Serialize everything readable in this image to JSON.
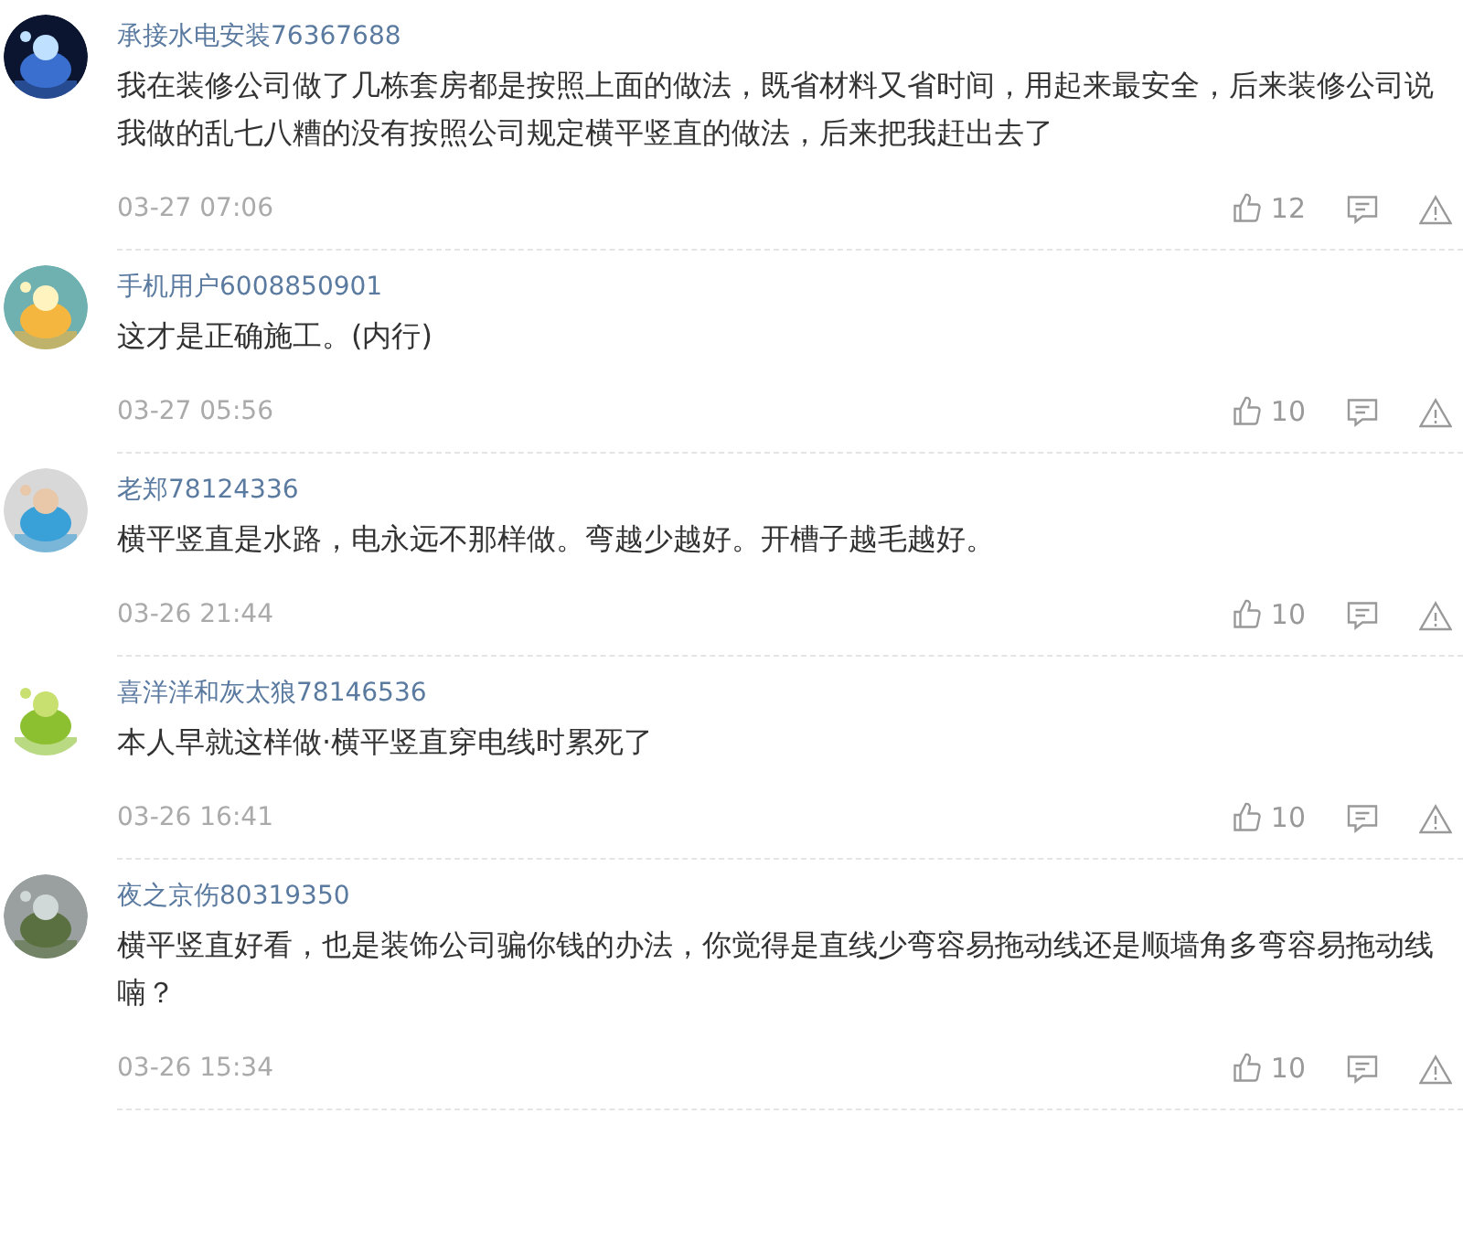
{
  "comments": [
    {
      "user": "承接水电安装76367688",
      "text": "我在装修公司做了几栋套房都是按照上面的做法，既省材料又省时间，用起来最安全，后来装修公司说我做的乱七八糟的没有按照公司规定横平竖直的做法，后来把我赶出去了",
      "time": "03-27 07:06",
      "likes": "12"
    },
    {
      "user": "手机用户6008850901",
      "text": "这才是正确施工。(内行)",
      "time": "03-27 05:56",
      "likes": "10"
    },
    {
      "user": "老郑78124336",
      "text": "横平竖直是水路，电永远不那样做。弯越少越好。开槽子越毛越好。",
      "time": "03-26 21:44",
      "likes": "10"
    },
    {
      "user": "喜洋洋和灰太狼78146536",
      "text": "本人早就这样做·横平竖直穿电线时累死了",
      "time": "03-26 16:41",
      "likes": "10"
    },
    {
      "user": "夜之京伤80319350",
      "text": "横平竖直好看，也是装饰公司骗你钱的办法，你觉得是直线少弯容易拖动线还是顺墙角多弯容易拖动线喃？",
      "time": "03-26 15:34",
      "likes": "10"
    }
  ]
}
